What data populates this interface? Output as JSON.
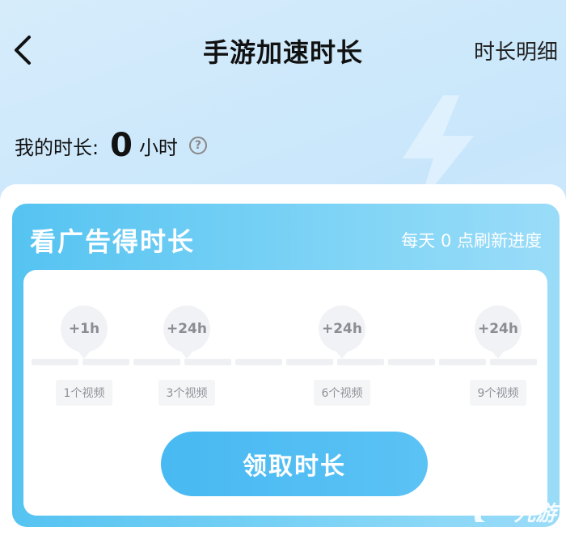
{
  "header": {
    "back_icon": "chevron-left-icon",
    "title": "手游加速时长",
    "detail_link": "时长明细"
  },
  "summary": {
    "label": "我的时长:",
    "value": "0",
    "unit": "小时",
    "help_icon": "question-circle-icon"
  },
  "ad_card": {
    "title": "看广告得时长",
    "refresh_note": "每天 0 点刷新进度",
    "rewards": [
      {
        "bubble": "+1h",
        "tag": "1个视频"
      },
      {
        "bubble": "+24h",
        "tag": "3个视频"
      },
      {
        "bubble": "+24h",
        "tag": "6个视频"
      },
      {
        "bubble": "+24h",
        "tag": "9个视频"
      }
    ],
    "claim_button": "领取时长"
  },
  "watermark": {
    "text": "九游"
  },
  "colors": {
    "accent": "#55c3f1",
    "button": "#48b9f2",
    "background": "#d6ecfb"
  }
}
